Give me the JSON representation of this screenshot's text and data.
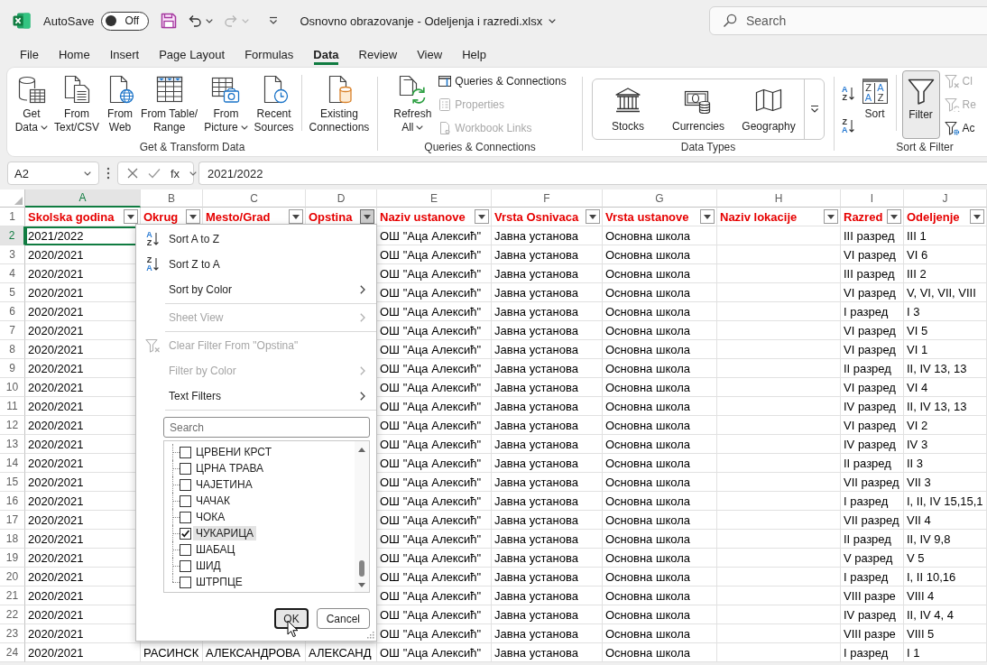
{
  "title_bar": {
    "autosave_label": "AutoSave",
    "autosave_toggle": {
      "label": "Off",
      "on": false
    },
    "document_title": "Osnovno obrazovanje - Odeljenja i razredi.xlsx",
    "search": {
      "placeholder": "Search"
    }
  },
  "menu_tabs": [
    {
      "label": "File",
      "selected": false
    },
    {
      "label": "Home",
      "selected": false
    },
    {
      "label": "Insert",
      "selected": false
    },
    {
      "label": "Page Layout",
      "selected": false
    },
    {
      "label": "Formulas",
      "selected": false
    },
    {
      "label": "Data",
      "selected": true
    },
    {
      "label": "Review",
      "selected": false
    },
    {
      "label": "View",
      "selected": false
    },
    {
      "label": "Help",
      "selected": false
    }
  ],
  "ribbon": {
    "groups": [
      {
        "label": "Get & Transform Data",
        "items": [
          {
            "kind": "large",
            "lines": [
              "Get",
              "Data"
            ],
            "menu": true,
            "pressed": false
          },
          {
            "kind": "large",
            "lines": [
              "From",
              "Text/CSV"
            ],
            "menu": false,
            "pressed": false
          },
          {
            "kind": "large",
            "lines": [
              "From",
              "Web"
            ],
            "menu": false,
            "pressed": false
          },
          {
            "kind": "large",
            "lines": [
              "From Table/",
              "Range"
            ],
            "menu": false,
            "pressed": false
          },
          {
            "kind": "large",
            "lines": [
              "From",
              "Picture"
            ],
            "menu": true,
            "pressed": false
          },
          {
            "kind": "large",
            "lines": [
              "Recent",
              "Sources"
            ],
            "menu": false,
            "pressed": false
          },
          {
            "kind": "separator"
          },
          {
            "kind": "large",
            "lines": [
              "Existing",
              "Connections"
            ],
            "menu": false,
            "pressed": false
          }
        ]
      },
      {
        "label": "Queries & Connections",
        "items": [
          {
            "kind": "large",
            "lines": [
              "Refresh",
              "All"
            ],
            "menu": true,
            "pressed": false
          },
          {
            "kind": "stack",
            "buttons": [
              {
                "label": "Queries & Connections",
                "disabled": false
              },
              {
                "label": "Properties",
                "disabled": true
              },
              {
                "label": "Workbook Links",
                "disabled": true
              }
            ]
          }
        ]
      },
      {
        "label": "Data Types",
        "items": [
          {
            "kind": "gallery",
            "options": [
              {
                "label": "Stocks"
              },
              {
                "label": "Currencies"
              },
              {
                "label": "Geography"
              }
            ]
          }
        ]
      },
      {
        "label": "Sort & Filter",
        "items": [
          {
            "kind": "sort-stack",
            "buttons": [
              {
                "letters": [
                  "A",
                  "Z"
                ]
              },
              {
                "letters": [
                  "Z",
                  "A"
                ]
              }
            ]
          },
          {
            "kind": "large",
            "lines": [
              "Sort"
            ],
            "letters": [
              "Z",
              "A",
              "A",
              "Z"
            ],
            "menu": false,
            "pressed": false
          },
          {
            "kind": "separator"
          },
          {
            "kind": "large",
            "lines": [
              "Filter"
            ],
            "menu": false,
            "pressed": true
          },
          {
            "kind": "stack",
            "buttons": [
              {
                "label": "Cl",
                "disabled": true
              },
              {
                "label": "Re",
                "disabled": true
              },
              {
                "label": "Ac",
                "disabled": false
              }
            ]
          }
        ]
      }
    ]
  },
  "formula_bar": {
    "name_box": "A2",
    "function_label": "fx",
    "formula": "2021/2022"
  },
  "sheet": {
    "columns": [
      {
        "letter": "A",
        "selected": true
      },
      {
        "letter": "B",
        "selected": false
      },
      {
        "letter": "C",
        "selected": false
      },
      {
        "letter": "D",
        "selected": false
      },
      {
        "letter": "E",
        "selected": false
      },
      {
        "letter": "F",
        "selected": false
      },
      {
        "letter": "G",
        "selected": false
      },
      {
        "letter": "H",
        "selected": false
      },
      {
        "letter": "I",
        "selected": false
      },
      {
        "letter": "J",
        "selected": false
      }
    ],
    "header_row": {
      "number": "1",
      "selected": false,
      "cells": [
        {
          "text": "Skolska godina",
          "filter_open": false
        },
        {
          "text": "Okrug",
          "filter_open": false
        },
        {
          "text": "Mesto/Grad",
          "filter_open": false
        },
        {
          "text": "Opstina",
          "filter_open": true
        },
        {
          "text": "Naziv ustanove",
          "filter_open": false
        },
        {
          "text": "Vrsta Osnivaca",
          "filter_open": false
        },
        {
          "text": "Vrsta ustanove",
          "filter_open": false
        },
        {
          "text": "Naziv lokacije",
          "filter_open": false
        },
        {
          "text": "Razred",
          "filter_open": false
        },
        {
          "text": "Odeljenje",
          "filter_open": false
        }
      ]
    },
    "rows": [
      {
        "number": "2",
        "selected": true,
        "cells": {
          "A": "2021/2022",
          "E": "ОШ \"Аца Алексић\"",
          "F": "Јавна установа",
          "G": "Основна школа",
          "I": "III разред",
          "J": "III 1"
        }
      },
      {
        "number": "3",
        "selected": false,
        "cells": {
          "A": "2020/2021",
          "E": "ОШ \"Аца Алексић\"",
          "F": "Јавна установа",
          "G": "Основна школа",
          "I": "VI разред",
          "J": "VI 6"
        }
      },
      {
        "number": "4",
        "selected": false,
        "cells": {
          "A": "2020/2021",
          "E": "ОШ \"Аца Алексић\"",
          "F": "Јавна установа",
          "G": "Основна школа",
          "I": "III разред",
          "J": "III 2"
        }
      },
      {
        "number": "5",
        "selected": false,
        "cells": {
          "A": "2020/2021",
          "E": "ОШ \"Аца Алексић\"",
          "F": "Јавна установа",
          "G": "Основна школа",
          "I": "VI разред",
          "J": "V, VI, VII, VIII"
        }
      },
      {
        "number": "6",
        "selected": false,
        "cells": {
          "A": "2020/2021",
          "E": "ОШ \"Аца Алексић\"",
          "F": "Јавна установа",
          "G": "Основна школа",
          "I": "I разред",
          "J": "I 3"
        }
      },
      {
        "number": "7",
        "selected": false,
        "cells": {
          "A": "2020/2021",
          "E": "ОШ \"Аца Алексић\"",
          "F": "Јавна установа",
          "G": "Основна школа",
          "I": "VI разред",
          "J": "VI 5"
        }
      },
      {
        "number": "8",
        "selected": false,
        "cells": {
          "A": "2020/2021",
          "E": "ОШ \"Аца Алексић\"",
          "F": "Јавна установа",
          "G": "Основна школа",
          "I": "VI разред",
          "J": "VI 1"
        }
      },
      {
        "number": "9",
        "selected": false,
        "cells": {
          "A": "2020/2021",
          "E": "ОШ \"Аца Алексић\"",
          "F": "Јавна установа",
          "G": "Основна школа",
          "I": "II разред",
          "J": "II, IV 13, 13"
        }
      },
      {
        "number": "10",
        "selected": false,
        "cells": {
          "A": "2020/2021",
          "E": "ОШ \"Аца Алексић\"",
          "F": "Јавна установа",
          "G": "Основна школа",
          "I": "VI разред",
          "J": "VI 4"
        }
      },
      {
        "number": "11",
        "selected": false,
        "cells": {
          "A": "2020/2021",
          "E": "ОШ \"Аца Алексић\"",
          "F": "Јавна установа",
          "G": "Основна школа",
          "I": "IV разред",
          "J": "II, IV 13, 13"
        }
      },
      {
        "number": "12",
        "selected": false,
        "cells": {
          "A": "2020/2021",
          "E": "ОШ \"Аца Алексић\"",
          "F": "Јавна установа",
          "G": "Основна школа",
          "I": "VI разред",
          "J": "VI 2"
        }
      },
      {
        "number": "13",
        "selected": false,
        "cells": {
          "A": "2020/2021",
          "E": "ОШ \"Аца Алексић\"",
          "F": "Јавна установа",
          "G": "Основна школа",
          "I": "IV разред",
          "J": "IV 3"
        }
      },
      {
        "number": "14",
        "selected": false,
        "cells": {
          "A": "2020/2021",
          "E": "ОШ \"Аца Алексић\"",
          "F": "Јавна установа",
          "G": "Основна школа",
          "I": "II разред",
          "J": "II 3"
        }
      },
      {
        "number": "15",
        "selected": false,
        "cells": {
          "A": "2020/2021",
          "E": "ОШ \"Аца Алексић\"",
          "F": "Јавна установа",
          "G": "Основна школа",
          "I": "VII разред",
          "J": "VII 3"
        }
      },
      {
        "number": "16",
        "selected": false,
        "cells": {
          "A": "2020/2021",
          "E": "ОШ \"Аца Алексић\"",
          "F": "Јавна установа",
          "G": "Основна школа",
          "I": "I разред",
          "J": "I, II, IV 15,15,1"
        }
      },
      {
        "number": "17",
        "selected": false,
        "cells": {
          "A": "2020/2021",
          "E": "ОШ \"Аца Алексић\"",
          "F": "Јавна установа",
          "G": "Основна школа",
          "I": "VII разред",
          "J": "VII 4"
        }
      },
      {
        "number": "18",
        "selected": false,
        "cells": {
          "A": "2020/2021",
          "E": "ОШ \"Аца Алексић\"",
          "F": "Јавна установа",
          "G": "Основна школа",
          "I": "II разред",
          "J": "II, IV 9,8"
        }
      },
      {
        "number": "19",
        "selected": false,
        "cells": {
          "A": "2020/2021",
          "E": "ОШ \"Аца Алексић\"",
          "F": "Јавна установа",
          "G": "Основна школа",
          "I": "V разред",
          "J": "V 5"
        }
      },
      {
        "number": "20",
        "selected": false,
        "cells": {
          "A": "2020/2021",
          "E": "ОШ \"Аца Алексић\"",
          "F": "Јавна установа",
          "G": "Основна школа",
          "I": "I разред",
          "J": "I, II 10,16"
        }
      },
      {
        "number": "21",
        "selected": false,
        "cells": {
          "A": "2020/2021",
          "E": "ОШ \"Аца Алексић\"",
          "F": "Јавна установа",
          "G": "Основна школа",
          "I": "VIII разре",
          "J": "VIII 4"
        }
      },
      {
        "number": "22",
        "selected": false,
        "cells": {
          "A": "2020/2021",
          "E": "ОШ \"Аца Алексић\"",
          "F": "Јавна установа",
          "G": "Основна школа",
          "I": "IV разред",
          "J": "II, IV 4, 4"
        }
      },
      {
        "number": "23",
        "selected": false,
        "cells": {
          "A": "2020/2021",
          "E": "ОШ \"Аца Алексић\"",
          "F": "Јавна установа",
          "G": "Основна школа",
          "I": "VIII разре",
          "J": "VIII 5"
        }
      },
      {
        "number": "24",
        "selected": false,
        "cells": {
          "A": "2020/2021",
          "B": "РАСИНСК",
          "C": "АЛЕКСАНДРОВА",
          "D": "АЛЕКСАНД",
          "E": "ОШ \"Аца Алексић\"",
          "F": "Јавна установа",
          "G": "Основна школа",
          "I": "I разред",
          "J": "I 1"
        }
      }
    ],
    "filter_menu": {
      "items": [
        {
          "kind": "sort",
          "label": "Sort A to Z",
          "icon_letters": [
            "A",
            "Z"
          ],
          "disabled": false,
          "submenu": false
        },
        {
          "kind": "sort",
          "label": "Sort Z to A",
          "icon_letters": [
            "Z",
            "A"
          ],
          "disabled": false,
          "submenu": false
        },
        {
          "kind": "command",
          "label": "Sort by Color",
          "disabled": false,
          "submenu": true
        },
        {
          "kind": "separator"
        },
        {
          "kind": "command",
          "label": "Sheet View",
          "disabled": true,
          "submenu": true
        },
        {
          "kind": "separator"
        },
        {
          "kind": "clear",
          "label": "Clear Filter From \"Opstina\"",
          "disabled": true,
          "submenu": false
        },
        {
          "kind": "command",
          "label": "Filter by Color",
          "disabled": true,
          "submenu": true
        },
        {
          "kind": "command",
          "label": "Text Filters",
          "disabled": false,
          "submenu": true
        },
        {
          "kind": "separator"
        }
      ],
      "search": {
        "placeholder": "Search"
      },
      "values": [
        {
          "label": "ЦРВЕНИ КРСТ",
          "checked": false,
          "selected": false
        },
        {
          "label": "ЦРНА ТРАВА",
          "checked": false,
          "selected": false
        },
        {
          "label": "ЧАЈЕТИНА",
          "checked": false,
          "selected": false
        },
        {
          "label": "ЧАЧАК",
          "checked": false,
          "selected": false
        },
        {
          "label": "ЧОКА",
          "checked": false,
          "selected": false
        },
        {
          "label": "ЧУКАРИЦА",
          "checked": true,
          "selected": true
        },
        {
          "label": "ШАБАЦ",
          "checked": false,
          "selected": false
        },
        {
          "label": "ШИД",
          "checked": false,
          "selected": false
        },
        {
          "label": "ШТРПЦЕ",
          "checked": false,
          "selected": false
        }
      ],
      "buttons": [
        {
          "label": "OK",
          "focused": true
        },
        {
          "label": "Cancel",
          "focused": false
        }
      ]
    }
  }
}
